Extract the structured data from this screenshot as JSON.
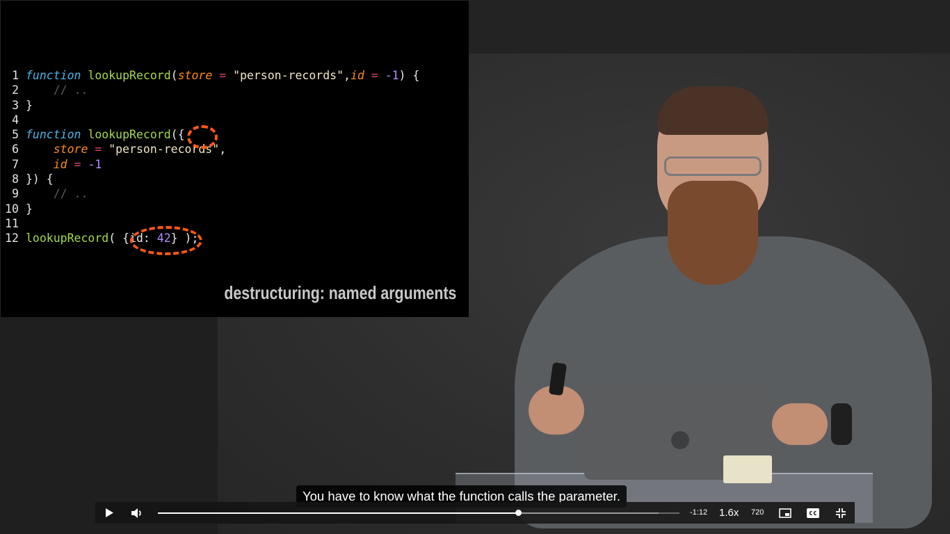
{
  "slide": {
    "code_lines": [
      {
        "num": "1",
        "tokens": [
          {
            "t": "function",
            "c": "kw"
          },
          {
            "t": " ",
            "c": "pl"
          },
          {
            "t": "lookupRecord",
            "c": "fn"
          },
          {
            "t": "(",
            "c": "pl"
          },
          {
            "t": "store",
            "c": "param"
          },
          {
            "t": " = ",
            "c": "op"
          },
          {
            "t": "\"person-records\"",
            "c": "str"
          },
          {
            "t": ",",
            "c": "pl"
          },
          {
            "t": "id",
            "c": "param"
          },
          {
            "t": " = ",
            "c": "op"
          },
          {
            "t": "-1",
            "c": "num"
          },
          {
            "t": ") {",
            "c": "pl"
          }
        ]
      },
      {
        "num": "2",
        "tokens": [
          {
            "t": "    // ..",
            "c": "cm"
          }
        ]
      },
      {
        "num": "3",
        "tokens": [
          {
            "t": "}",
            "c": "pl"
          }
        ]
      },
      {
        "num": "4",
        "tokens": []
      },
      {
        "num": "5",
        "tokens": [
          {
            "t": "function",
            "c": "kw"
          },
          {
            "t": " ",
            "c": "pl"
          },
          {
            "t": "lookupRecord",
            "c": "fn"
          },
          {
            "t": "({",
            "c": "pl"
          }
        ]
      },
      {
        "num": "6",
        "tokens": [
          {
            "t": "    ",
            "c": "pl"
          },
          {
            "t": "store",
            "c": "param"
          },
          {
            "t": " = ",
            "c": "op"
          },
          {
            "t": "\"person-records\"",
            "c": "str"
          },
          {
            "t": ",",
            "c": "pl"
          }
        ]
      },
      {
        "num": "7",
        "tokens": [
          {
            "t": "    ",
            "c": "pl"
          },
          {
            "t": "id",
            "c": "param"
          },
          {
            "t": " = ",
            "c": "op"
          },
          {
            "t": "-1",
            "c": "num"
          }
        ]
      },
      {
        "num": "8",
        "tokens": [
          {
            "t": "}) {",
            "c": "pl"
          }
        ]
      },
      {
        "num": "9",
        "tokens": [
          {
            "t": "    // ..",
            "c": "cm"
          }
        ]
      },
      {
        "num": "10",
        "tokens": [
          {
            "t": "}",
            "c": "pl"
          }
        ]
      },
      {
        "num": "11",
        "tokens": []
      },
      {
        "num": "12",
        "tokens": [
          {
            "t": "lookupRecord",
            "c": "fn"
          },
          {
            "t": "( ",
            "c": "pl"
          },
          {
            "t": "{id: ",
            "c": "pl"
          },
          {
            "t": "42",
            "c": "num"
          },
          {
            "t": "} );",
            "c": "pl"
          }
        ]
      }
    ],
    "caption": "destructuring: named arguments",
    "highlight_color": "#ff5a14"
  },
  "subtitle": "You have to know what the function calls the parameter.",
  "player": {
    "play_icon": "play-icon",
    "volume_icon": "volume-icon",
    "progress_fraction": 0.691,
    "buffered_fraction": 0.96,
    "time_remaining": "-1:12",
    "speed": "1.6x",
    "quality": "720",
    "pip_icon": "picture-in-picture-icon",
    "cc_icon": "closed-captions-icon",
    "exit_fullscreen_icon": "exit-fullscreen-icon"
  }
}
